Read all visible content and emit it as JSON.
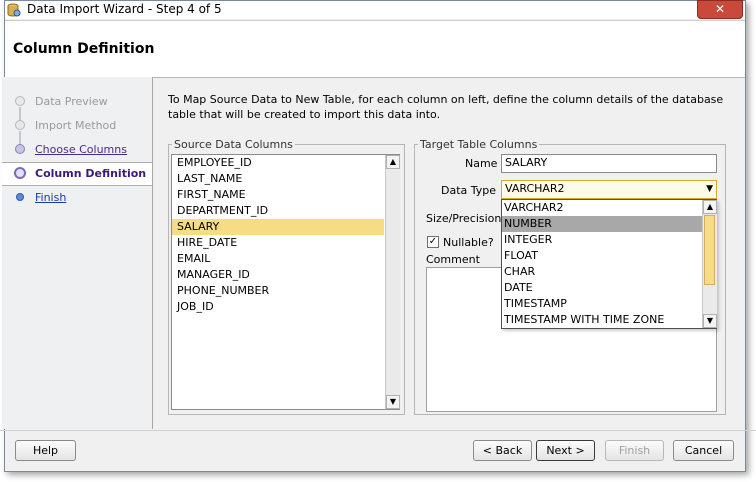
{
  "window": {
    "title": "Data Import Wizard - Step 4 of 5",
    "close_label": "✕"
  },
  "header": {
    "title": "Column Definition"
  },
  "steps": [
    {
      "label": "Data Preview",
      "state": "done"
    },
    {
      "label": "Import Method",
      "state": "done"
    },
    {
      "label": "Choose Columns",
      "state": "link"
    },
    {
      "label": "Column Definition",
      "state": "current"
    },
    {
      "label": "Finish",
      "state": "finish"
    }
  ],
  "instructions": "To Map Source Data to New Table, for each column on left, define the column details of the database table that will be created to import this data into.",
  "source": {
    "legend": "Source Data Columns",
    "columns": [
      "EMPLOYEE_ID",
      "LAST_NAME",
      "FIRST_NAME",
      "DEPARTMENT_ID",
      "SALARY",
      "HIRE_DATE",
      "EMAIL",
      "MANAGER_ID",
      "PHONE_NUMBER",
      "JOB_ID"
    ],
    "selected": "SALARY"
  },
  "target": {
    "legend": "Target Table Columns",
    "name_label": "Name",
    "name_value": "SALARY",
    "datatype_label": "Data Type",
    "datatype_value": "VARCHAR2",
    "size_label": "Size/Precision",
    "nullable_label": "Nullable?",
    "nullable_checked": true,
    "comment_label": "Comment",
    "datatype_options": [
      "VARCHAR2",
      "NUMBER",
      "INTEGER",
      "FLOAT",
      "CHAR",
      "DATE",
      "TIMESTAMP",
      "TIMESTAMP WITH TIME ZONE"
    ],
    "highlighted_option": "NUMBER"
  },
  "buttons": {
    "help": "Help",
    "back": "< Back",
    "next": "Next >",
    "finish": "Finish",
    "cancel": "Cancel"
  },
  "colors": {
    "selection": "#f7dc86",
    "highlight": "#a8a8a8",
    "link": "#4a2a8a"
  }
}
